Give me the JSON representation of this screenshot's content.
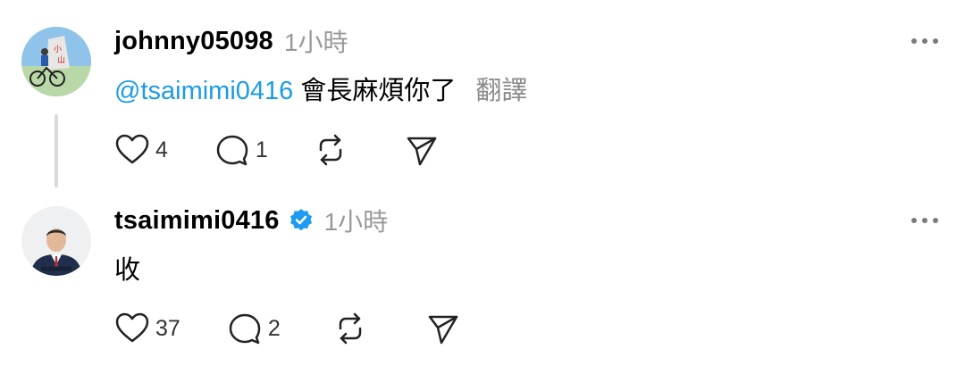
{
  "posts": [
    {
      "username": "johnny05098",
      "time": "1小時",
      "mention": "@tsaimimi0416",
      "text": "會長麻煩你了",
      "translate": "翻譯",
      "likes": "4",
      "replies": "1",
      "verified": false
    },
    {
      "username": "tsaimimi0416",
      "time": "1小時",
      "text": "收",
      "likes": "37",
      "replies": "2",
      "verified": true
    }
  ],
  "colors": {
    "mention": "#1c9be6",
    "verified": "#1d9bf0",
    "muted": "#999999"
  }
}
